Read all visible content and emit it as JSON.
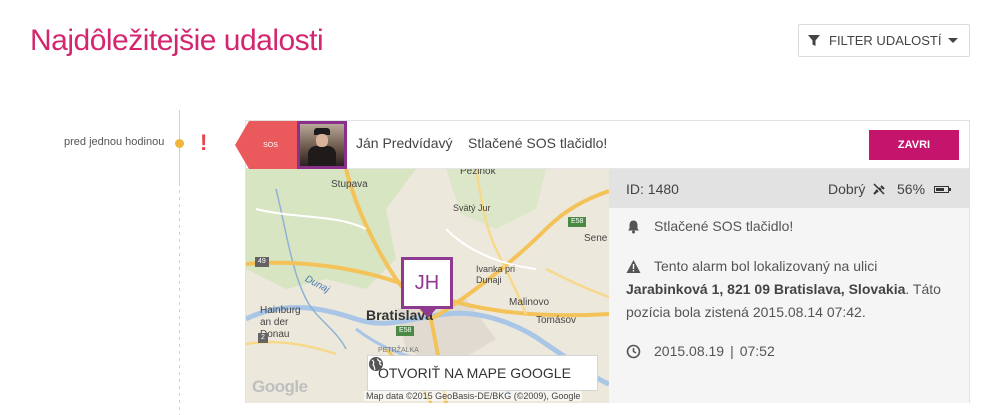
{
  "page": {
    "title": "Najdôležitejšie udalosti"
  },
  "filter": {
    "label": "FILTER UDALOSTÍ",
    "icon": "filter-icon"
  },
  "timeline": {
    "time_label": "pred jednou hodinou",
    "alert_symbol": "!",
    "dot_color": "#f0b63c"
  },
  "event": {
    "tag": "SOS",
    "tag_color": "#ea5a5d",
    "person_name": "Ján Predvídavý",
    "message": "Stlačené SOS tlačidlo!",
    "close_label": "ZAVRI",
    "close_color": "#c4146c",
    "accent_color": "#8e3a91"
  },
  "map": {
    "marker_initials": "JH",
    "open_button_label": "OTVORIŤ NA MAPE GOOGLE",
    "google_logo": "Google",
    "credit": "Map data ©2015 GeoBasis-DE/BKG (©2009), Google",
    "labels": {
      "pezinok": "Pezinok",
      "stupava": "Stupava",
      "svaty_jur": "Svätý Jur",
      "senec": "Sene",
      "ivanka": "Ivanka pri Dunaji",
      "malinovo": "Malinovo",
      "tomasov": "Tomásov",
      "hainburg": "Hainburg an der Donau",
      "dunaj": "Dunaj",
      "bratislava": "Bratislava",
      "petrzalka": "PETRŽALKA",
      "road_e58_a": "E58",
      "road_e58_b": "E58",
      "road_49": "49",
      "road_2": "2"
    }
  },
  "details": {
    "id_label": "ID: 1480",
    "signal_label": "Dobrý",
    "battery_label": "56%",
    "message": "Stlačené SOS tlačidlo!",
    "location_prefix": "Tento alarm bol lokalizovaný na ulici ",
    "location_address": "Jarabinková 1, 821 09 Bratislava, Slovakia",
    "location_suffix": ". Táto pozícia bola zistená 2015.08.14 07:42.",
    "date": "2015.08.19",
    "separator": "|",
    "time": "07:52"
  }
}
